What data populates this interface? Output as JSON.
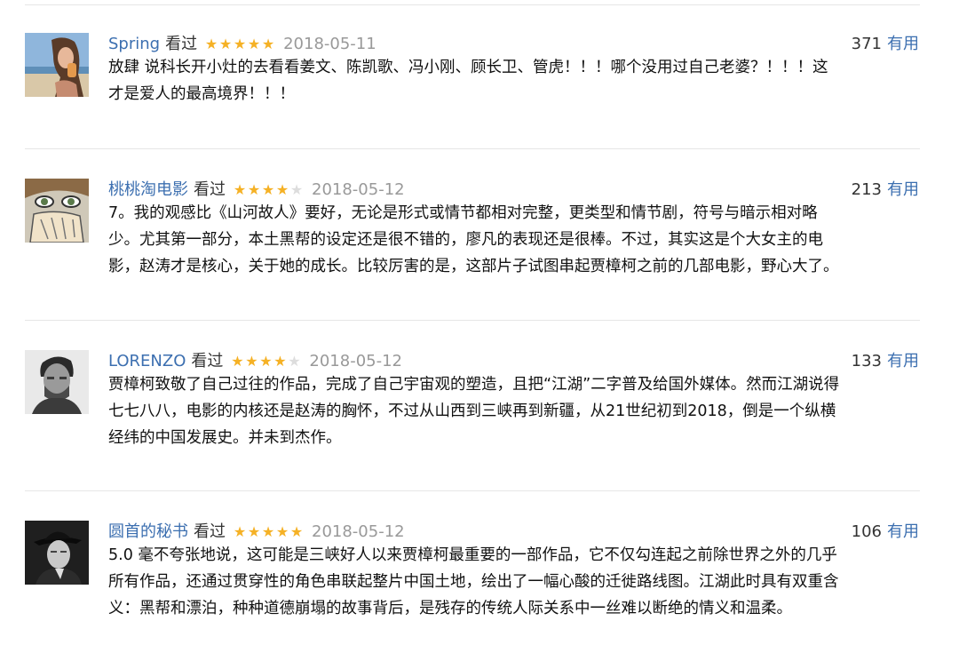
{
  "rating_colors": {
    "filled": "#f5b125",
    "empty": "#dddddd"
  },
  "link_color": "#3c6fb0",
  "comments": [
    {
      "user": "Spring",
      "status": "看过",
      "rating": 5,
      "date": "2018-05-11",
      "votes": "371",
      "vote_label": "有用",
      "avatar_icon": "woman-portrait-icon",
      "lines": [
        "放肆 说科长开小灶的去看看姜文、陈凯歌、冯小刚、顾长卫、管虎！！！哪个没用过自己老婆？！！！这",
        "才是爱人的最高境界！！！"
      ]
    },
    {
      "user": "桃桃淘电影",
      "status": "看过",
      "rating": 4,
      "date": "2018-05-12",
      "votes": "213",
      "vote_label": "有用",
      "avatar_icon": "anime-face-icon",
      "lines": [
        "7。我的观感比《山河故人》要好，无论是形式或情节都相对完整，更类型和情节剧，符号与暗示相对略",
        "少。尤其第一部分，本土黑帮的设定还是很不错的，廖凡的表现还是很棒。不过，其实这是个大女主的电",
        "影，赵涛才是核心，关于她的成长。比较厉害的是，这部片子试图串起贾樟柯之前的几部电影，野心大了。"
      ]
    },
    {
      "user": "LORENZO",
      "status": "看过",
      "rating": 4,
      "date": "2018-05-12",
      "votes": "133",
      "vote_label": "有用",
      "avatar_icon": "man-portrait-icon",
      "lines": [
        "贾樟柯致敬了自己过往的作品，完成了自己宇宙观的塑造，且把“江湖”二字普及给国外媒体。然而江湖说得",
        "七七八八，电影的内核还是赵涛的胸怀，不过从山西到三峡再到新疆，从21世纪初到2018，倒是一个纵横",
        "经纬的中国发展史。并未到杰作。"
      ]
    },
    {
      "user": "圆首的秘书",
      "status": "看过",
      "rating": 5,
      "date": "2018-05-12",
      "votes": "106",
      "vote_label": "有用",
      "avatar_icon": "hat-man-portrait-icon",
      "lines": [
        "5.0 毫不夸张地说，这可能是三峡好人以来贾樟柯最重要的一部作品，它不仅勾连起之前除世界之外的几乎",
        "所有作品，还通过贯穿性的角色串联起整片中国土地，绘出了一幅心酸的迁徙路线图。江湖此时具有双重含",
        "义：黑帮和漂泊，种种道德崩塌的故事背后，是残存的传统人际关系中一丝难以断绝的情义和温柔。"
      ]
    }
  ]
}
